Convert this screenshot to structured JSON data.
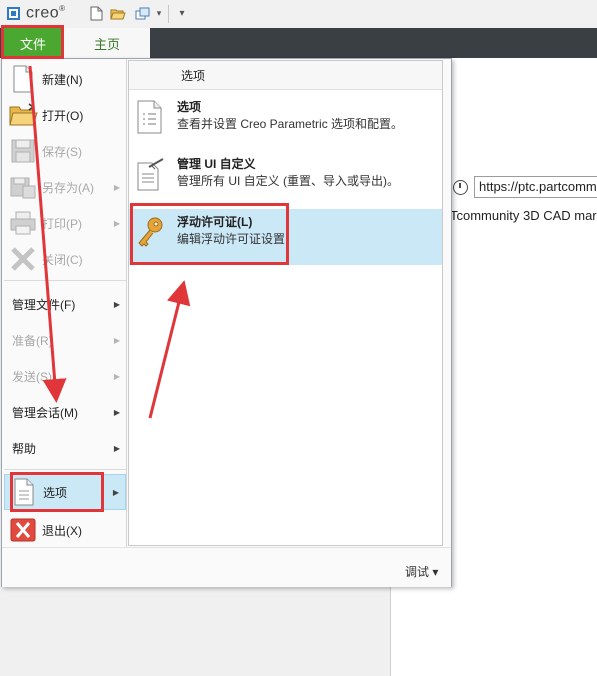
{
  "titlebar": {
    "app_name": "creo",
    "trademark": "®",
    "quick_access": [
      "new-icon",
      "open-icon",
      "window-icon",
      "dropdown-icon",
      "customize-icon"
    ]
  },
  "ribbon": {
    "tabs": [
      {
        "label": "文件",
        "active": true,
        "color": "#4aa830"
      },
      {
        "label": "主页",
        "active": false
      }
    ]
  },
  "background": {
    "browser_url": "https://ptc.partcomm",
    "browser_tab_text": "Tcommunity 3D CAD mar"
  },
  "file_menu": {
    "items": [
      {
        "label": "新建(N)",
        "icon": "new-document-icon",
        "enabled": true,
        "submenu": false
      },
      {
        "label": "打开(O)",
        "icon": "open-folder-icon",
        "enabled": true,
        "submenu": false
      },
      {
        "label": "保存(S)",
        "icon": "save-icon",
        "enabled": false,
        "submenu": false
      },
      {
        "label": "另存为(A)",
        "icon": "save-as-icon",
        "enabled": false,
        "submenu": true
      },
      {
        "label": "打印(P)",
        "icon": "print-icon",
        "enabled": false,
        "submenu": true
      },
      {
        "label": "关闭(C)",
        "icon": "close-icon",
        "enabled": false,
        "submenu": false
      },
      {
        "label": "管理文件(F)",
        "enabled": true,
        "submenu": true
      },
      {
        "label": "准备(R)",
        "enabled": false,
        "submenu": true
      },
      {
        "label": "发送(S)",
        "enabled": false,
        "submenu": true
      },
      {
        "label": "管理会话(M)",
        "enabled": true,
        "submenu": true
      },
      {
        "label": "帮助",
        "enabled": true,
        "submenu": true
      },
      {
        "label": "选项",
        "icon": "options-document-icon",
        "enabled": true,
        "submenu": true,
        "selected": true
      },
      {
        "label": "退出(X)",
        "icon": "exit-icon",
        "enabled": true,
        "submenu": false
      }
    ],
    "submenu": {
      "title": "选项",
      "items": [
        {
          "title": "选项",
          "description": "查看并设置 Creo Parametric 选项和配置。",
          "icon": "options-list-icon"
        },
        {
          "title": "管理 UI 自定义",
          "description": "管理所有 UI 自定义 (重置、导入或导出)。",
          "icon": "ui-customize-icon"
        },
        {
          "title": "浮动许可证(L)",
          "description": "编辑浮动许可证设置",
          "icon": "key-icon",
          "selected": true
        }
      ]
    },
    "footer": {
      "debug_label": "调试 ▾"
    }
  },
  "colors": {
    "accent_green": "#4aa830",
    "highlight_blue": "#cbe8f7",
    "annotation_red": "#e0363a"
  }
}
